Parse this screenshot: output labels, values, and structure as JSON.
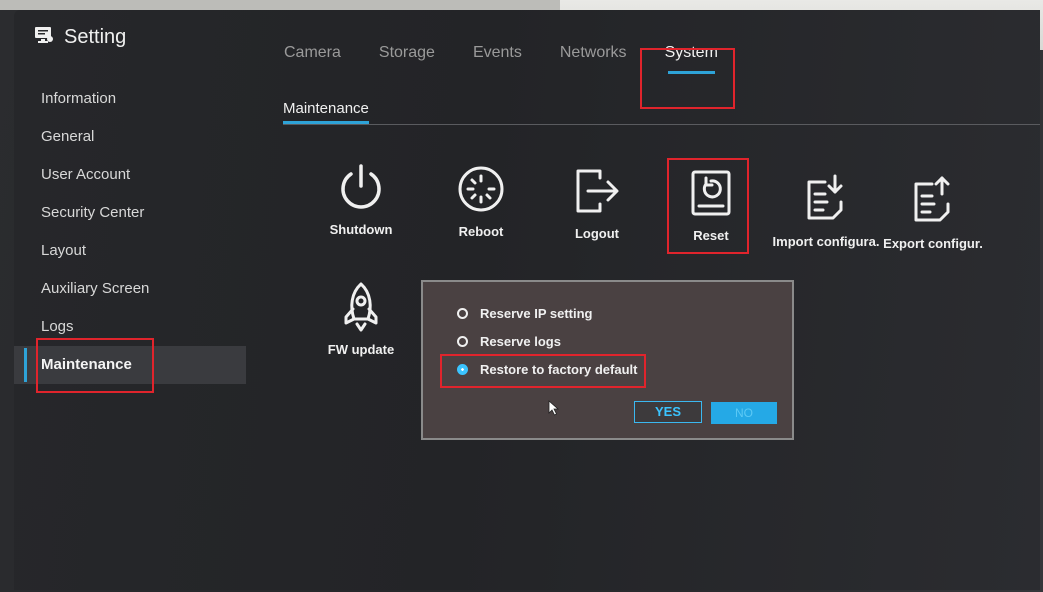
{
  "app": {
    "title": "Setting",
    "icon": "setting-monitor-icon"
  },
  "sidebar": {
    "items": [
      {
        "label": "Information"
      },
      {
        "label": "General"
      },
      {
        "label": "User Account"
      },
      {
        "label": "Security Center"
      },
      {
        "label": "Layout"
      },
      {
        "label": "Auxiliary Screen"
      },
      {
        "label": "Logs"
      },
      {
        "label": "Maintenance",
        "active": true
      }
    ]
  },
  "tabs": [
    {
      "label": "Camera"
    },
    {
      "label": "Storage"
    },
    {
      "label": "Events"
    },
    {
      "label": "Networks"
    },
    {
      "label": "System",
      "active": true
    }
  ],
  "subtab": {
    "label": "Maintenance"
  },
  "actions": [
    {
      "label": "Shutdown",
      "icon": "power-icon"
    },
    {
      "label": "Reboot",
      "icon": "reboot-icon"
    },
    {
      "label": "Logout",
      "icon": "logout-icon"
    },
    {
      "label": "Reset",
      "icon": "reset-icon"
    },
    {
      "label": "Import configura.",
      "icon": "import-config-icon"
    },
    {
      "label": "Export configur.",
      "icon": "export-config-icon"
    },
    {
      "label": "FW update",
      "icon": "rocket-icon"
    }
  ],
  "dialog": {
    "options": [
      {
        "label": "Reserve IP setting",
        "checked": false
      },
      {
        "label": "Reserve logs",
        "checked": false
      },
      {
        "label": "Restore to factory default",
        "checked": true
      }
    ],
    "yes_label": "YES",
    "no_label": "NO"
  },
  "colors": {
    "accent": "#2ea3d8",
    "highlight": "#e0242c",
    "dialog_bg": "#4a4142"
  }
}
